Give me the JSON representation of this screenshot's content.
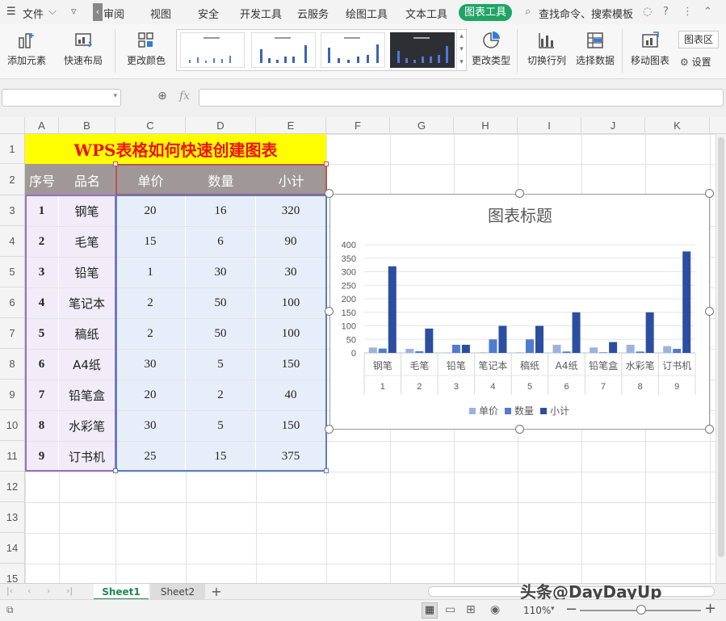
{
  "menubar": {
    "file": "文件",
    "review": "审阅",
    "tabs": [
      "视图",
      "安全",
      "开发工具",
      "云服务",
      "绘图工具",
      "文本工具"
    ],
    "active_tab": "图表工具",
    "search": "查找命令、搜索模板"
  },
  "ribbon": {
    "add_element": "添加元素",
    "quick_layout": "快速布局",
    "change_color": "更改颜色",
    "change_type": "更改类型",
    "switch_row_col": "切换行列",
    "select_data": "选择数据",
    "move_chart": "移动图表",
    "chart_area": "图表区",
    "settings": "设置"
  },
  "formula": {
    "fx": "fx"
  },
  "columns": [
    "A",
    "B",
    "C",
    "D",
    "E",
    "F",
    "G",
    "H",
    "I",
    "J",
    "K"
  ],
  "rows": [
    "1",
    "2",
    "3",
    "4",
    "5",
    "6",
    "7",
    "8",
    "9",
    "10",
    "11",
    "12",
    "13",
    "14",
    "15"
  ],
  "sheet": {
    "title": "WPS表格如何快速创建图表",
    "headers": [
      "序号",
      "品名",
      "单价",
      "数量",
      "小计"
    ],
    "data": [
      [
        "1",
        "钢笔",
        "20",
        "16",
        "320"
      ],
      [
        "2",
        "毛笔",
        "15",
        "6",
        "90"
      ],
      [
        "3",
        "铅笔",
        "1",
        "30",
        "30"
      ],
      [
        "4",
        "笔记本",
        "2",
        "50",
        "100"
      ],
      [
        "5",
        "稿纸",
        "2",
        "50",
        "100"
      ],
      [
        "6",
        "A4纸",
        "30",
        "5",
        "150"
      ],
      [
        "7",
        "铅笔盒",
        "20",
        "2",
        "40"
      ],
      [
        "8",
        "水彩笔",
        "30",
        "5",
        "150"
      ],
      [
        "9",
        "订书机",
        "25",
        "15",
        "375"
      ]
    ]
  },
  "chart_data": {
    "type": "bar",
    "title": "图表标题",
    "categories": [
      "钢笔",
      "毛笔",
      "铅笔",
      "笔记本",
      "稿纸",
      "A4纸",
      "铅笔盒",
      "水彩笔",
      "订书机"
    ],
    "category_numbers": [
      "1",
      "2",
      "3",
      "4",
      "5",
      "6",
      "7",
      "8",
      "9"
    ],
    "series": [
      {
        "name": "单价",
        "values": [
          20,
          15,
          1,
          2,
          2,
          30,
          20,
          30,
          25
        ],
        "color": "#9bb4dd"
      },
      {
        "name": "数量",
        "values": [
          16,
          6,
          30,
          50,
          50,
          5,
          2,
          5,
          15
        ],
        "color": "#4f7bd0"
      },
      {
        "name": "小计",
        "values": [
          320,
          90,
          30,
          100,
          100,
          150,
          40,
          150,
          375
        ],
        "color": "#2d4ea0"
      }
    ],
    "ylim": [
      0,
      400
    ],
    "yticks": [
      "400",
      "350",
      "300",
      "250",
      "200",
      "150",
      "100",
      "50",
      "0"
    ],
    "legend": "bottom",
    "grid": true
  },
  "tabs": {
    "sheet1": "Sheet1",
    "sheet2": "Sheet2",
    "add": "+"
  },
  "watermark": "头条@DayDayUp",
  "status": {
    "zoom": "110%"
  },
  "colors": {
    "title_bg": "#ffff00",
    "title_text": "#ee1111",
    "header_bg": "#a09898",
    "accent": "#21a366"
  }
}
